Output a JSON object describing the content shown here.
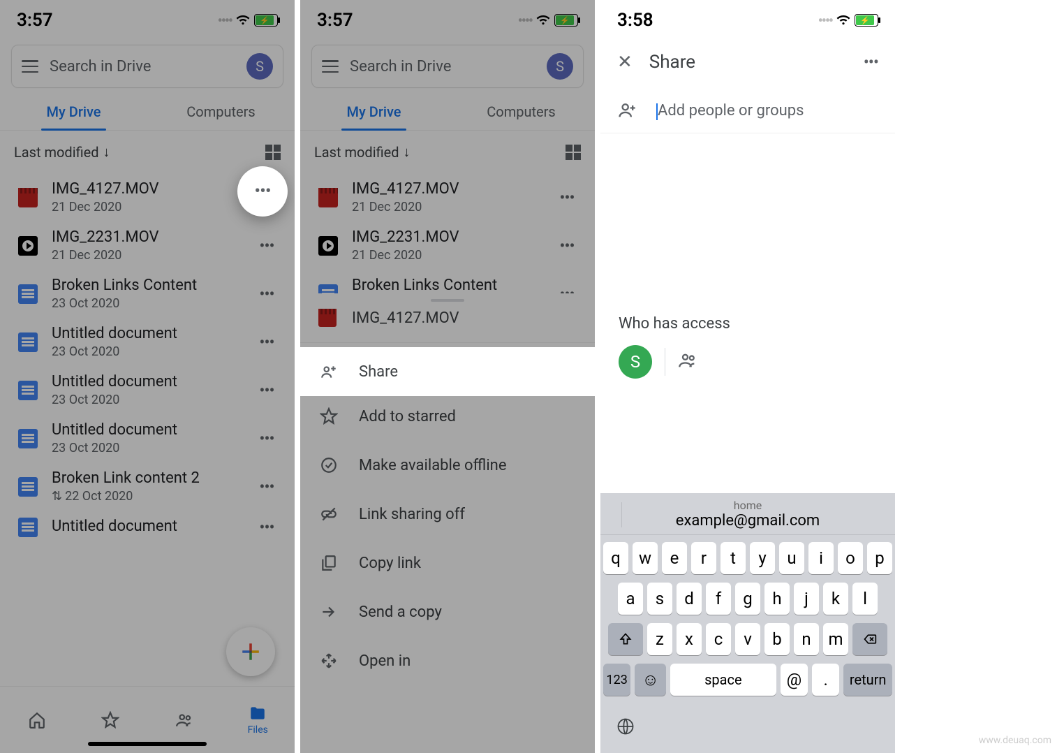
{
  "screen1": {
    "time": "3:57",
    "search_placeholder": "Search in Drive",
    "avatar_letter": "S",
    "tab_mydrive": "My Drive",
    "tab_computers": "Computers",
    "sort_label": "Last modified",
    "files": [
      {
        "name": "IMG_4127.MOV",
        "date": "21 Dec 2020",
        "icon": "vid"
      },
      {
        "name": "IMG_2231.MOV",
        "date": "21 Dec 2020",
        "icon": "play"
      },
      {
        "name": "Broken Links Content",
        "date": "23 Oct 2020",
        "icon": "doc"
      },
      {
        "name": "Untitled document",
        "date": "23 Oct 2020",
        "icon": "doc"
      },
      {
        "name": "Untitled document",
        "date": "23 Oct 2020",
        "icon": "doc"
      },
      {
        "name": "Untitled document",
        "date": "23 Oct 2020",
        "icon": "doc"
      },
      {
        "name": "Broken Link content 2",
        "date": "22 Oct 2020",
        "icon": "doc",
        "shared": true
      },
      {
        "name": "Untitled document",
        "date": "",
        "icon": "doc"
      }
    ],
    "tabbar_files": "Files"
  },
  "screen2": {
    "time": "3:57",
    "sheet_file": "IMG_4127.MOV",
    "items": [
      "Share",
      "Add to starred",
      "Make available offline",
      "Link sharing off",
      "Copy link",
      "Send a copy",
      "Open in"
    ]
  },
  "screen3": {
    "time": "3:58",
    "title": "Share",
    "add_placeholder": "Add people or groups",
    "who_label": "Who has access",
    "avatar_letter": "S",
    "sugg_home": "home",
    "sugg_email": "example@gmail.com",
    "keys_row1": [
      "q",
      "w",
      "e",
      "r",
      "t",
      "y",
      "u",
      "i",
      "o",
      "p"
    ],
    "keys_row2": [
      "a",
      "s",
      "d",
      "f",
      "g",
      "h",
      "j",
      "k",
      "l"
    ],
    "keys_row3": [
      "z",
      "x",
      "c",
      "v",
      "b",
      "n",
      "m"
    ],
    "key_123": "123",
    "key_space": "space",
    "key_at": "@",
    "key_dot": ".",
    "key_return": "return"
  },
  "watermark": "www.deuaq.com"
}
